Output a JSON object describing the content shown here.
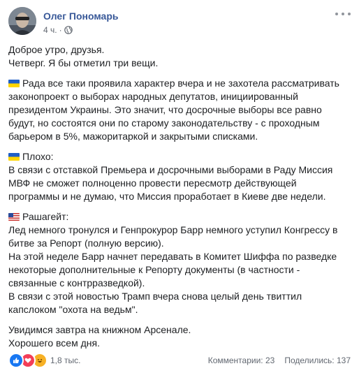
{
  "post": {
    "author": "Олег Пономарь",
    "time": "4 ч.",
    "dot": "·",
    "visibility_icon": "globe-icon",
    "paragraphs": [
      {
        "flag": "",
        "lines": [
          "Доброе утро, друзья.",
          "Четверг. Я бы отметил три вещи."
        ]
      },
      {
        "flag": "ukraine-flag",
        "lines": [
          "Рада все таки проявила характер вчера и не захотела рассматривать",
          "законопроект о выборах народных депутатов, инициированный",
          "президентом Украины. Это значит, что досрочные выборы все равно",
          "будут, но состоятся они по старому законодательству - с проходным",
          "барьером в 5%, мажоритаркой и закрытыми списками."
        ]
      },
      {
        "flag": "ukraine-flag",
        "lines": [
          "Плохо:",
          "В связи с отставкой Премьера и досрочными выборами в Раду Миссия",
          "МВФ не сможет полноценно провести пересмотр действующей",
          "программы и не думаю, что Миссия проработает в Киеве две недели."
        ]
      },
      {
        "flag": "us-flag",
        "lines": [
          "Рашагейт:",
          "Лед немного тронулся и Генпрокурор Барр немного уступил Конгрессу в",
          "битве за Репорт (полную версию).",
          "На этой неделе Барр начнет передавать в Комитет Шиффа по разведке",
          "некоторые дополнительные к Репорту документы (в частности -",
          "связанные с контрразведкой).",
          "В связи с этой новостью Трамп вчера снова целый день твиттил",
          "капслоком \"охота на ведьм\"."
        ]
      },
      {
        "flag": "",
        "lines": [
          "Увидимся завтра на книжном Арсенале.",
          "Хорошего всем дня."
        ]
      }
    ]
  },
  "footer": {
    "reaction_icons": [
      "like-icon",
      "love-icon",
      "haha-icon"
    ],
    "reactions_count": "1,8 тыс.",
    "comments": "Комментарии: 23",
    "shares": "Поделились: 137"
  },
  "colors": {
    "author": "#385898",
    "secondary_text": "#616770",
    "like": "#1877f2",
    "love": "#f33e58",
    "haha": "#f7b125"
  }
}
